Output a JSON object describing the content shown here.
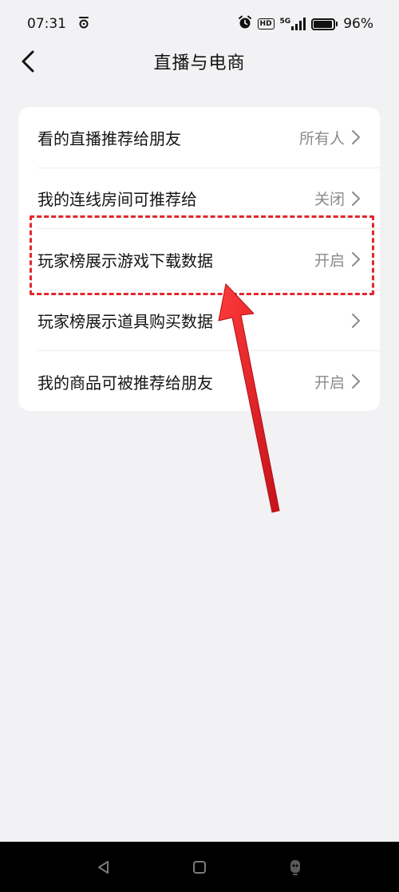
{
  "status_bar": {
    "time": "07:31",
    "hd_label": "HD",
    "network_label": "5G",
    "battery_text": "96%",
    "battery_level": 0.96
  },
  "header": {
    "title": "直播与电商",
    "back_icon": "chevron-left-icon"
  },
  "settings": {
    "rows": [
      {
        "label": "看的直播推荐给朋友",
        "value": "所有人"
      },
      {
        "label": "我的连线房间可推荐给",
        "value": "关闭"
      },
      {
        "label": "玩家榜展示游戏下载数据",
        "value": "开启"
      },
      {
        "label": "玩家榜展示道具购买数据",
        "value": ""
      },
      {
        "label": "我的商品可被推荐给朋友",
        "value": "开启"
      }
    ]
  },
  "annotation": {
    "color": "#e0282e",
    "highlighted_row_index": 2
  },
  "colors": {
    "background": "#f2f1f3",
    "card": "#ffffff",
    "value_text": "#8b8b8b",
    "nav_bar": "#000000"
  }
}
